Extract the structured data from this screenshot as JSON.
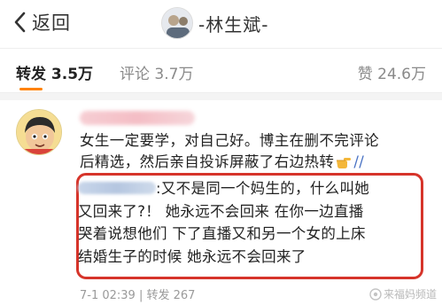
{
  "header": {
    "back_label": "返回",
    "title": "-林生斌-"
  },
  "tabs": [
    {
      "label": "转发 3.5万",
      "active": true
    },
    {
      "label": "评论 3.7万",
      "active": false
    },
    {
      "label": "赞 24.6万",
      "active": false
    }
  ],
  "comment": {
    "lines": [
      "女生一定要学，对自己好。博主在删不完评论",
      "后精选，然后亲自投诉屏蔽了右边热转"
    ],
    "trailing_slashes": "//",
    "quote": {
      "line1_text": ":又不是同一个妈生的，什么叫她",
      "lines": [
        "又回来了?！ 她永远不会回来 在你一边直播",
        "哭着说想他们 下了直播又和另一个女的上床",
        "结婚生子的时候 她永远不会回来了"
      ]
    },
    "meta": "7-1 02:39 | 转发 267",
    "watermark": "来福妈频道"
  },
  "colors": {
    "accent": "#ff8200",
    "highlight_border": "#d6342a",
    "link": "#4a73c4",
    "muted": "#9a9a9a"
  },
  "icons": [
    "back-chevron-icon",
    "pointing-hand-icon",
    "watermark-logo-icon"
  ]
}
